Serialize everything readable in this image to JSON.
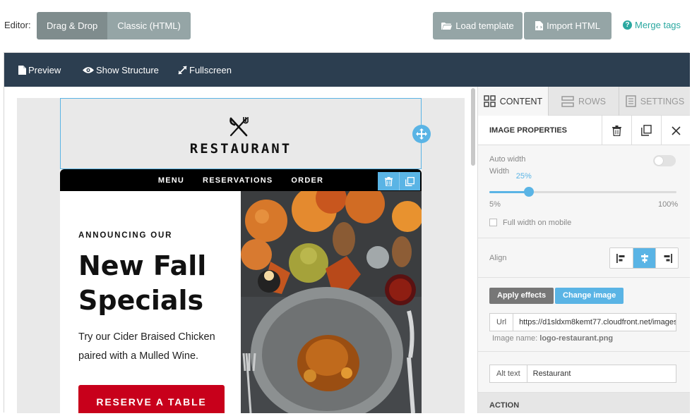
{
  "topbar": {
    "editor_label": "Editor:",
    "modes": [
      {
        "label": "Drag & Drop",
        "active": true
      },
      {
        "label": "Classic (HTML)",
        "active": false
      }
    ],
    "load_template": "Load template",
    "import_html": "Import HTML",
    "merge_tags": "Merge tags",
    "button_color": "#95a5a6",
    "accent_color": "#2aa8a0"
  },
  "toolbar": {
    "preview": "Preview",
    "show_structure": "Show Structure",
    "fullscreen": "Fullscreen",
    "background": "#2c3e50"
  },
  "email": {
    "logo_text": "RESTAURANT",
    "logo_icon": "fork-knife-icon",
    "nav": [
      "MENU",
      "RESERVATIONS",
      "ORDER"
    ],
    "kicker": "ANNOUNCING OUR",
    "headline": "New Fall Specials",
    "body": "Try our Cider Braised Chicken paired with a Mulled Wine.",
    "cta": "RESERVE A TABLE",
    "cta_color": "#c8001b",
    "selection_color": "#5ab4e5"
  },
  "panel": {
    "tabs": [
      {
        "label": "CONTENT",
        "icon": "grid-icon",
        "active": true
      },
      {
        "label": "ROWS",
        "icon": "rows-icon",
        "active": false
      },
      {
        "label": "SETTINGS",
        "icon": "settings-icon",
        "active": false
      }
    ],
    "title": "IMAGE PROPERTIES",
    "auto_width_label": "Auto width",
    "auto_width_on": false,
    "width_label": "Width",
    "width_value": "25%",
    "width_fraction": 0.25,
    "width_min": "5%",
    "width_max": "100%",
    "full_width_mobile": "Full width on mobile",
    "full_width_mobile_checked": false,
    "align_label": "Align",
    "align_selected": "center",
    "apply_effects": "Apply effects",
    "change_image": "Change image",
    "url_label": "Url",
    "url_value": "https://d1sldxm8kemt77.cloudfront.net/images/8",
    "image_name_label": "Image name:",
    "image_name": "logo-restaurant.png",
    "alt_label": "Alt text",
    "alt_value": "Restaurant",
    "action_label": "ACTION"
  }
}
